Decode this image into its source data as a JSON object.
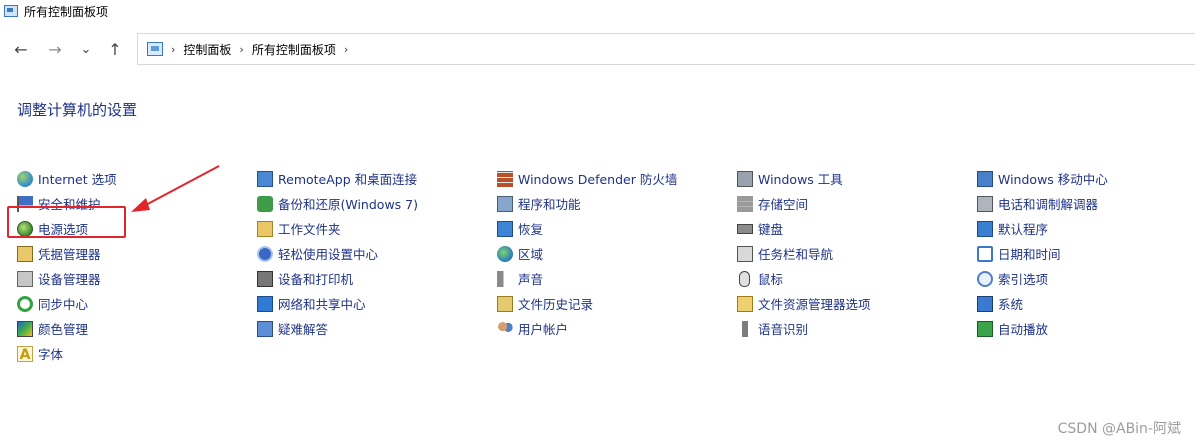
{
  "window": {
    "title": "所有控制面板项"
  },
  "nav": {
    "back": "←",
    "forward": "→",
    "recent": "⌄",
    "up": "↑"
  },
  "breadcrumb": {
    "items": [
      "控制面板",
      "所有控制面板项"
    ],
    "sep": "›"
  },
  "heading": "调整计算机的设置",
  "columns": [
    [
      {
        "label": "Internet 选项",
        "icon": "internet-options-icon"
      },
      {
        "label": "安全和维护",
        "icon": "security-maintenance-icon"
      },
      {
        "label": "电源选项",
        "icon": "power-options-icon"
      },
      {
        "label": "凭据管理器",
        "icon": "credential-manager-icon"
      },
      {
        "label": "设备管理器",
        "icon": "device-manager-icon"
      },
      {
        "label": "同步中心",
        "icon": "sync-center-icon"
      },
      {
        "label": "颜色管理",
        "icon": "color-management-icon"
      },
      {
        "label": "字体",
        "icon": "fonts-icon"
      }
    ],
    [
      {
        "label": "RemoteApp 和桌面连接",
        "icon": "remoteapp-icon"
      },
      {
        "label": "备份和还原(Windows 7)",
        "icon": "backup-restore-icon"
      },
      {
        "label": "工作文件夹",
        "icon": "work-folders-icon"
      },
      {
        "label": "轻松使用设置中心",
        "icon": "ease-of-access-icon"
      },
      {
        "label": "设备和打印机",
        "icon": "devices-printers-icon"
      },
      {
        "label": "网络和共享中心",
        "icon": "network-sharing-icon"
      },
      {
        "label": "疑难解答",
        "icon": "troubleshooting-icon"
      }
    ],
    [
      {
        "label": "Windows Defender 防火墙",
        "icon": "firewall-icon"
      },
      {
        "label": "程序和功能",
        "icon": "programs-features-icon"
      },
      {
        "label": "恢复",
        "icon": "recovery-icon"
      },
      {
        "label": "区域",
        "icon": "region-icon"
      },
      {
        "label": "声音",
        "icon": "sound-icon"
      },
      {
        "label": "文件历史记录",
        "icon": "file-history-icon"
      },
      {
        "label": "用户帐户",
        "icon": "user-accounts-icon"
      }
    ],
    [
      {
        "label": "Windows 工具",
        "icon": "windows-tools-icon"
      },
      {
        "label": "存储空间",
        "icon": "storage-spaces-icon"
      },
      {
        "label": "键盘",
        "icon": "keyboard-icon"
      },
      {
        "label": "任务栏和导航",
        "icon": "taskbar-icon"
      },
      {
        "label": "鼠标",
        "icon": "mouse-icon"
      },
      {
        "label": "文件资源管理器选项",
        "icon": "explorer-options-icon"
      },
      {
        "label": "语音识别",
        "icon": "speech-recognition-icon"
      }
    ],
    [
      {
        "label": "Windows 移动中心",
        "icon": "mobility-center-icon"
      },
      {
        "label": "电话和调制解调器",
        "icon": "phone-modem-icon"
      },
      {
        "label": "默认程序",
        "icon": "default-programs-icon"
      },
      {
        "label": "日期和时间",
        "icon": "date-time-icon"
      },
      {
        "label": "索引选项",
        "icon": "indexing-options-icon"
      },
      {
        "label": "系统",
        "icon": "system-icon"
      },
      {
        "label": "自动播放",
        "icon": "autoplay-icon"
      }
    ]
  ],
  "watermark": "CSDN @ABin-阿斌",
  "colors": {
    "link": "#1e3287",
    "highlight": "#e1252a"
  }
}
